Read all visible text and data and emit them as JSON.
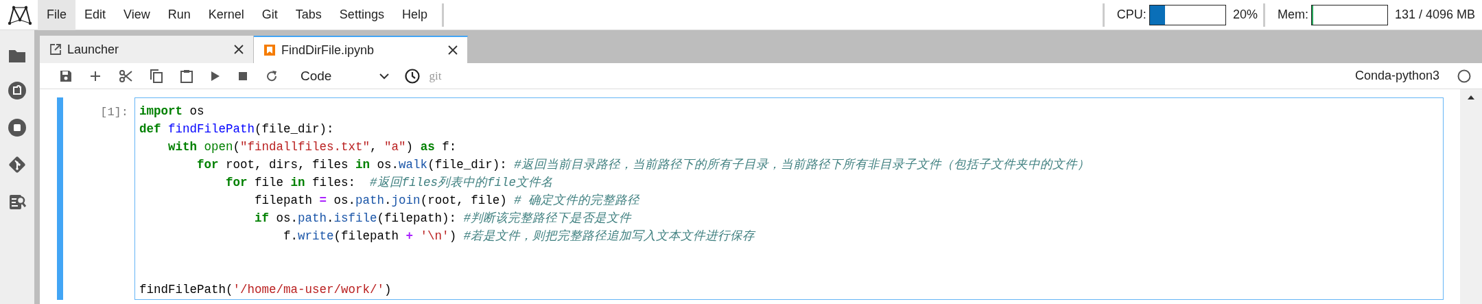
{
  "menubar": {
    "items": [
      {
        "label": "File",
        "selected": true
      },
      {
        "label": "Edit",
        "selected": false
      },
      {
        "label": "View",
        "selected": false
      },
      {
        "label": "Run",
        "selected": false
      },
      {
        "label": "Kernel",
        "selected": false
      },
      {
        "label": "Git",
        "selected": false
      },
      {
        "label": "Tabs",
        "selected": false
      },
      {
        "label": "Settings",
        "selected": false
      },
      {
        "label": "Help",
        "selected": false
      }
    ],
    "cpu": {
      "label": "CPU:",
      "level": 0.2,
      "reading": "20%"
    },
    "mem": {
      "label": "Mem:",
      "level": 0.02,
      "reading": "131 / 4096 MB"
    }
  },
  "tabs": [
    {
      "label": "Launcher",
      "kind": "launcher",
      "selected": false
    },
    {
      "label": "FindDirFile.ipynb",
      "kind": "notebook",
      "selected": true
    }
  ],
  "toolbar": {
    "cell_type": "Code",
    "git_label": "git",
    "kernel": "Conda-python3",
    "kernel_busy": false
  },
  "cell": {
    "prompt": "[1]:",
    "selected": true,
    "focused": true,
    "code_blocks": [
      [
        [
          {
            "kind": "keyword",
            "text": "import"
          },
          {
            "kind": "plain",
            "text": " os"
          }
        ],
        [
          {
            "kind": "keyword",
            "text": "def "
          },
          {
            "kind": "definition",
            "text": "findFilePath"
          },
          {
            "kind": "plain",
            "text": "(file_dir):"
          }
        ],
        [
          {
            "kind": "keyword",
            "text": "    with "
          },
          {
            "kind": "builtin",
            "text": "open"
          },
          {
            "kind": "plain",
            "text": "("
          },
          {
            "kind": "string",
            "text": "\"findallfiles.txt\""
          },
          {
            "kind": "plain",
            "text": ", "
          },
          {
            "kind": "string",
            "text": "\"a\""
          },
          {
            "kind": "plain",
            "text": ") "
          },
          {
            "kind": "keyword",
            "text": "as"
          },
          {
            "kind": "plain",
            "text": " f:"
          }
        ],
        [
          {
            "kind": "keyword",
            "text": "        for"
          },
          {
            "kind": "plain",
            "text": " root, dirs, files "
          },
          {
            "kind": "keyword",
            "text": "in"
          },
          {
            "kind": "plain",
            "text": " os."
          },
          {
            "kind": "property",
            "text": "walk"
          },
          {
            "kind": "plain",
            "text": "(file_dir): "
          },
          {
            "kind": "comment",
            "text": "#返回当前目录路径，当前路径下的所有子目录，当前路径下所有非目录子文件（包括子文件夹中的文件）"
          }
        ],
        [
          {
            "kind": "keyword",
            "text": "            for"
          },
          {
            "kind": "plain",
            "text": " file "
          },
          {
            "kind": "keyword",
            "text": "in"
          },
          {
            "kind": "plain",
            "text": " files:  "
          },
          {
            "kind": "comment",
            "text": "#返回files列表中的file文件名"
          }
        ],
        [
          {
            "kind": "plain",
            "text": "                filepath "
          },
          {
            "kind": "operator",
            "text": "="
          },
          {
            "kind": "plain",
            "text": " os."
          },
          {
            "kind": "property",
            "text": "path"
          },
          {
            "kind": "plain",
            "text": "."
          },
          {
            "kind": "property",
            "text": "join"
          },
          {
            "kind": "plain",
            "text": "(root, file) "
          },
          {
            "kind": "comment",
            "text": "# 确定文件的完整路径"
          }
        ],
        [
          {
            "kind": "keyword",
            "text": "                if"
          },
          {
            "kind": "plain",
            "text": " os."
          },
          {
            "kind": "property",
            "text": "path"
          },
          {
            "kind": "plain",
            "text": "."
          },
          {
            "kind": "property",
            "text": "isfile"
          },
          {
            "kind": "plain",
            "text": "(filepath): "
          },
          {
            "kind": "comment",
            "text": "#判断该完整路径下是否是文件"
          }
        ],
        [
          {
            "kind": "plain",
            "text": "                    f."
          },
          {
            "kind": "property",
            "text": "write"
          },
          {
            "kind": "plain",
            "text": "(filepath "
          },
          {
            "kind": "operator",
            "text": "+ "
          },
          {
            "kind": "string",
            "text": "'\\n'"
          },
          {
            "kind": "plain",
            "text": ") "
          },
          {
            "kind": "comment",
            "text": "#若是文件，则把完整路径追加写入文本文件进行保存"
          }
        ]
      ],
      [
        [
          {
            "kind": "plain",
            "text": "findFilePath("
          },
          {
            "kind": "string",
            "text": "'/home/ma-user/work/'"
          },
          {
            "kind": "plain",
            "text": ")"
          }
        ]
      ]
    ]
  }
}
